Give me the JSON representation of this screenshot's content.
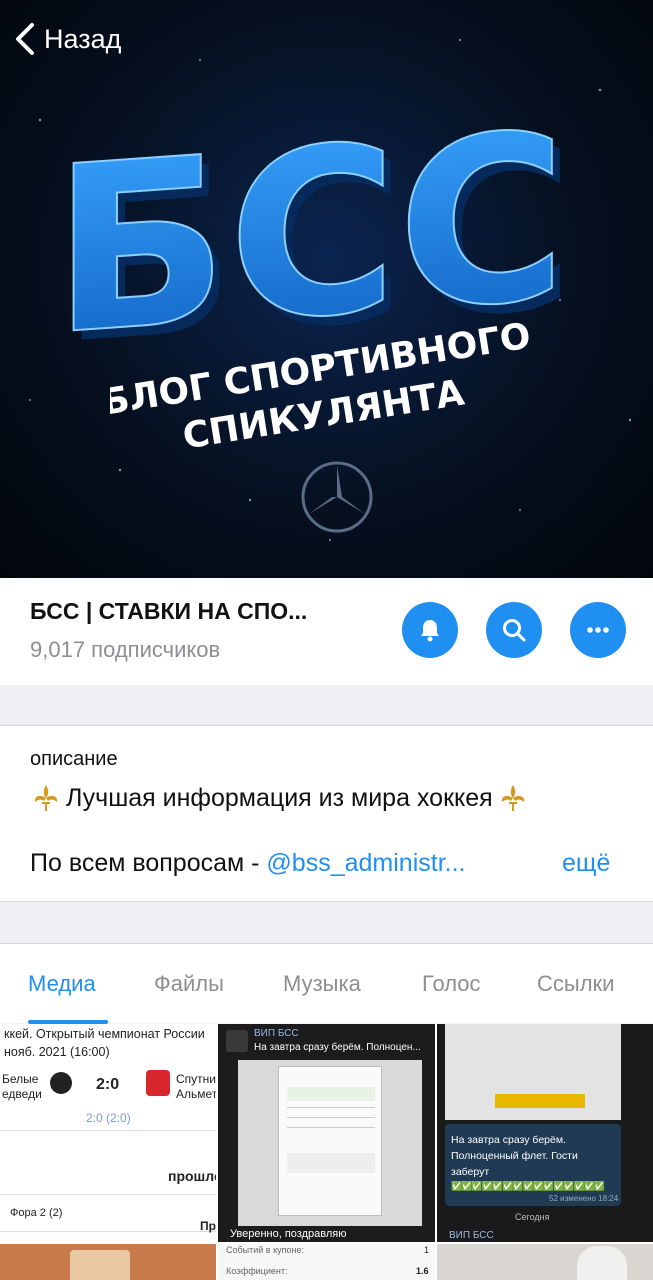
{
  "nav": {
    "back_label": "Назад"
  },
  "hero": {
    "logo_text": "БСС",
    "sub_line1": "БЛОГ СПОРТИВНОГО",
    "sub_line2": "СПИКУЛЯНТА"
  },
  "channel": {
    "title": "БСС | СТАВКИ НА СПО...",
    "subscribers": "9,017 подписчиков",
    "actions": {
      "mute_icon": "bell-icon",
      "search_icon": "search-icon",
      "more_icon": "more-icon"
    }
  },
  "description": {
    "label": "описание",
    "line1": "Лучшая информация из мира хоккея",
    "line2_prefix": "По всем вопросам - ",
    "line2_link": "@bss_administr...",
    "more": "ещё"
  },
  "tabs": [
    {
      "label": "Медиа",
      "active": true
    },
    {
      "label": "Файлы",
      "active": false
    },
    {
      "label": "Музыка",
      "active": false
    },
    {
      "label": "Голос",
      "active": false
    },
    {
      "label": "Ссылки",
      "active": false
    }
  ],
  "media": {
    "m1": {
      "header1": "ккей. Открытый чемпионат России",
      "header2": "нояб. 2021 (16:00)",
      "team1_line1": "Белые",
      "team1_line2": "едведи",
      "score": "2:0",
      "period_score": "2:0 (2:0)",
      "team2_line1": "Спутни",
      "team2_line2": "Альмет",
      "past": "прошло",
      "market": "Фора 2 (2)",
      "pr": "Пр"
    },
    "m2": {
      "sender": "ВИП БСС",
      "preview": "На завтра сразу берём. Полноцен...",
      "caption": "Уверенно, поздравляю"
    },
    "m3": {
      "msg": "На завтра сразу берём. Полноценный флет. Гости заберут",
      "checks": "✅✅✅✅✅✅✅✅✅✅✅✅✅✅✅",
      "meta": "52 изменено 18:24",
      "today": "Сегодня",
      "sender": "ВИП БСС"
    },
    "m5": {
      "row1_label": "Событий в купоне:",
      "row1_value": "1",
      "row2_label": "Коэффициент:",
      "row2_value": "1.6"
    }
  },
  "colors": {
    "accent": "#1f8ff2",
    "hero_blue": "#1a7fe8",
    "bg": "#efeff4"
  }
}
